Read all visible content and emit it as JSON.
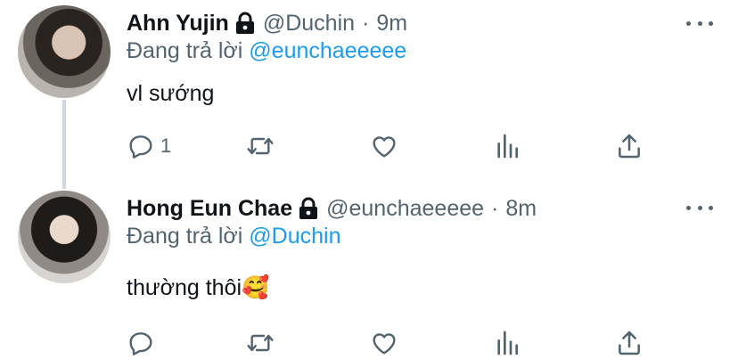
{
  "tweets": [
    {
      "name": "Ahn Yujin",
      "handle": "@Duchin",
      "separator": "·",
      "time": "9m",
      "replying_prefix": "Đang trả lời",
      "replying_to": "@eunchaeeeee",
      "text": "vl sướng",
      "reply_count": "1",
      "icons": [
        "lock-icon",
        "more-icon",
        "reply-icon",
        "retweet-icon",
        "like-icon",
        "stats-icon",
        "share-icon"
      ]
    },
    {
      "name": "Hong Eun Chae",
      "handle": "@eunchaeeeee",
      "separator": "·",
      "time": "8m",
      "replying_prefix": "Đang trả lời",
      "replying_to": "@Duchin",
      "text": "thường thôi🥰",
      "icons": [
        "lock-icon",
        "more-icon",
        "reply-icon",
        "retweet-icon",
        "like-icon",
        "stats-icon",
        "share-icon"
      ]
    }
  ],
  "colors": {
    "text": "#0f1419",
    "secondary": "#536471",
    "link": "#1d9bf0",
    "thread_line": "#cfd9de"
  }
}
